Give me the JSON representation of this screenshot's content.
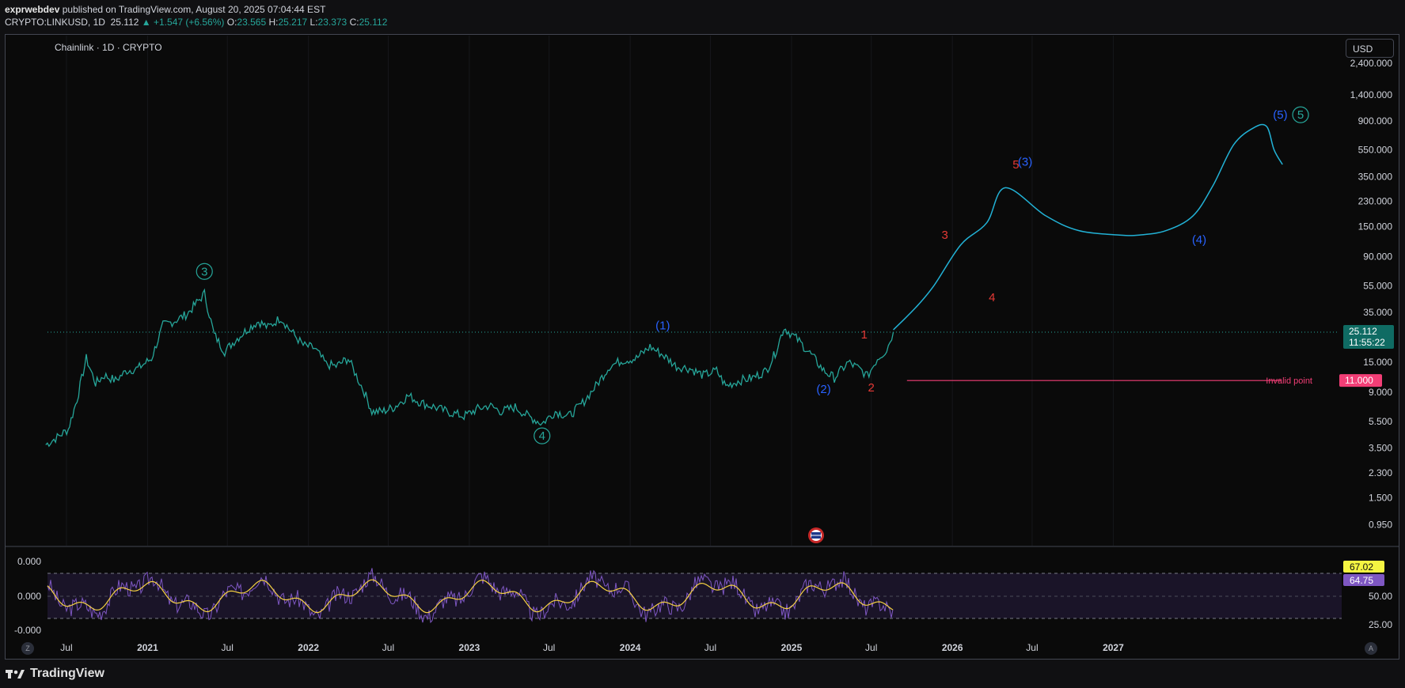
{
  "header": {
    "author": "exprwebdev",
    "published_text": "published on TradingView.com, August 20, 2025 07:04:44 EST",
    "symbol": "CRYPTO:LINKUSD, 1D",
    "last": "25.112",
    "change": "+1.547 (+6.56%)",
    "o_label": "O:",
    "o_value": "23.565",
    "h_label": "H:",
    "h_value": "25.217",
    "l_label": "L:",
    "l_value": "23.373",
    "c_label": "C:",
    "c_value": "25.112"
  },
  "chart_title": "Chainlink · 1D · CRYPTO",
  "currency_button": "USD",
  "price_label": "25.112",
  "countdown_label": "11:55:22",
  "invalid_label": "Invalid point",
  "invalid_value": "11.000",
  "osc_badge_yellow": "67.02",
  "osc_badge_purple": "64.75",
  "footer_brand": "TradingView",
  "corner_left": "Z",
  "corner_right": "A",
  "colors": {
    "background": "#0a0a0a",
    "price_line": "#26a69a",
    "wave_teal": "#26a69a",
    "wave_blue": "#2962ff",
    "wave_red": "#e53935",
    "projection": "#22b2d6",
    "invalid": "#f23e76",
    "osc_purple": "#7e57c2",
    "osc_yellow": "#f5d142"
  },
  "chart_data": {
    "type": "line",
    "title": "Chainlink · 1D · CRYPTO",
    "y_scale": "log",
    "y_ticks": [
      "2,400.000",
      "1,400.000",
      "900.000",
      "550.000",
      "350.000",
      "230.000",
      "150.000",
      "90.000",
      "55.000",
      "35.000",
      "15.000",
      "9.000",
      "5.500",
      "3.500",
      "2.300",
      "1.500",
      "0.950"
    ],
    "x_ticks": [
      "Jul",
      "2021",
      "Jul",
      "2022",
      "Jul",
      "2023",
      "Jul",
      "2024",
      "Jul",
      "2025",
      "Jul",
      "2026",
      "Jul",
      "2027"
    ],
    "price_series": {
      "name": "LINKUSD",
      "dates": [
        "2020-05-15",
        "2020-06-10",
        "2020-07-05",
        "2020-07-25",
        "2020-08-15",
        "2020-09-05",
        "2020-09-25",
        "2020-10-20",
        "2020-11-15",
        "2020-12-10",
        "2021-01-10",
        "2021-02-05",
        "2021-03-01",
        "2021-04-01",
        "2021-05-10",
        "2021-06-01",
        "2021-06-25",
        "2021-07-20",
        "2021-08-20",
        "2021-09-10",
        "2021-10-01",
        "2021-10-30",
        "2021-11-20",
        "2021-12-20",
        "2022-01-15",
        "2022-02-10",
        "2022-03-05",
        "2022-04-01",
        "2022-05-08",
        "2022-05-25",
        "2022-06-18",
        "2022-07-15",
        "2022-08-15",
        "2022-09-15",
        "2022-10-15",
        "2022-11-10",
        "2022-12-20",
        "2023-01-20",
        "2023-02-15",
        "2023-03-15",
        "2023-04-15",
        "2023-05-15",
        "2023-06-15",
        "2023-07-15",
        "2023-08-15",
        "2023-09-15",
        "2023-10-15",
        "2023-11-15",
        "2023-12-15",
        "2024-01-15",
        "2024-02-15",
        "2024-03-15",
        "2024-04-15",
        "2024-05-15",
        "2024-06-15",
        "2024-07-15",
        "2024-08-05",
        "2024-09-05",
        "2024-10-05",
        "2024-11-05",
        "2024-11-25",
        "2024-12-15",
        "2025-01-15",
        "2025-02-15",
        "2025-03-15",
        "2025-04-08",
        "2025-05-10",
        "2025-06-10",
        "2025-06-22",
        "2025-07-15",
        "2025-08-05",
        "2025-08-20"
      ],
      "values": [
        3.7,
        4.2,
        4.8,
        8.0,
        16.0,
        10.5,
        12.0,
        11.0,
        13.0,
        13.5,
        16.0,
        28.0,
        30.0,
        34.0,
        48.0,
        24.0,
        18.0,
        22.0,
        27.0,
        30.0,
        27.0,
        32.0,
        26.0,
        20.0,
        19.0,
        14.5,
        14.0,
        16.0,
        9.0,
        6.5,
        6.5,
        7.0,
        8.5,
        7.5,
        7.0,
        6.5,
        6.0,
        6.8,
        7.2,
        6.5,
        7.0,
        6.0,
        5.3,
        6.5,
        6.0,
        7.5,
        10.0,
        14.0,
        15.5,
        16.0,
        19.5,
        17.0,
        14.0,
        13.5,
        12.0,
        13.0,
        10.0,
        11.0,
        11.5,
        13.0,
        17.5,
        27.0,
        22.0,
        17.0,
        13.0,
        11.5,
        15.0,
        13.0,
        11.8,
        16.0,
        18.5,
        25.112
      ]
    },
    "projection_series": {
      "name": "",
      "dates": [
        "2025-08-20",
        "2025-10-10",
        "2025-11-20",
        "2026-01-20",
        "2026-03-20",
        "2026-05-01",
        "2026-08-01",
        "2026-10-15",
        "2027-01-15",
        "2027-03-01",
        "2027-05-01",
        "2027-07-01",
        "2027-08-15",
        "2027-10-01",
        "2027-11-15",
        "2027-12-15",
        "2028-01-01",
        "2028-01-20"
      ],
      "values": [
        26,
        38,
        55,
        110,
        160,
        290,
        180,
        140,
        130,
        130,
        140,
        180,
        300,
        600,
        800,
        820,
        550,
        430
      ]
    },
    "wave_labels": [
      {
        "text": "3",
        "date": "2021-05-10",
        "value": 70,
        "style": "teal-circle"
      },
      {
        "text": "4",
        "date": "2023-06-15",
        "value": 4.3,
        "style": "teal-circle"
      },
      {
        "text": "5",
        "date": "2028-03-01",
        "value": 1000,
        "style": "teal-circle"
      },
      {
        "text": "(1)",
        "date": "2024-03-15",
        "value": 28,
        "style": "blue"
      },
      {
        "text": "(2)",
        "date": "2025-03-15",
        "value": 9.5,
        "style": "blue"
      },
      {
        "text": "(3)",
        "date": "2026-06-15",
        "value": 450,
        "style": "blue"
      },
      {
        "text": "(4)",
        "date": "2027-07-15",
        "value": 120,
        "style": "blue"
      },
      {
        "text": "(5)",
        "date": "2028-01-15",
        "value": 1000,
        "style": "blue"
      },
      {
        "text": "1",
        "date": "2025-06-15",
        "value": 24,
        "style": "red"
      },
      {
        "text": "2",
        "date": "2025-07-01",
        "value": 9.8,
        "style": "red"
      },
      {
        "text": "3",
        "date": "2025-12-15",
        "value": 130,
        "style": "red"
      },
      {
        "text": "4",
        "date": "2026-04-01",
        "value": 45,
        "style": "red"
      },
      {
        "text": "5",
        "date": "2026-05-25",
        "value": 430,
        "style": "red"
      }
    ],
    "invalid_level": 11.0,
    "oscillator": {
      "y_ticks_left": [
        "0.000",
        "0.000",
        "-0.000"
      ],
      "y_ticks_right": [
        "50.00",
        "25.00"
      ],
      "band": [
        30,
        70
      ],
      "last_values": [
        67.02,
        64.75
      ]
    }
  }
}
